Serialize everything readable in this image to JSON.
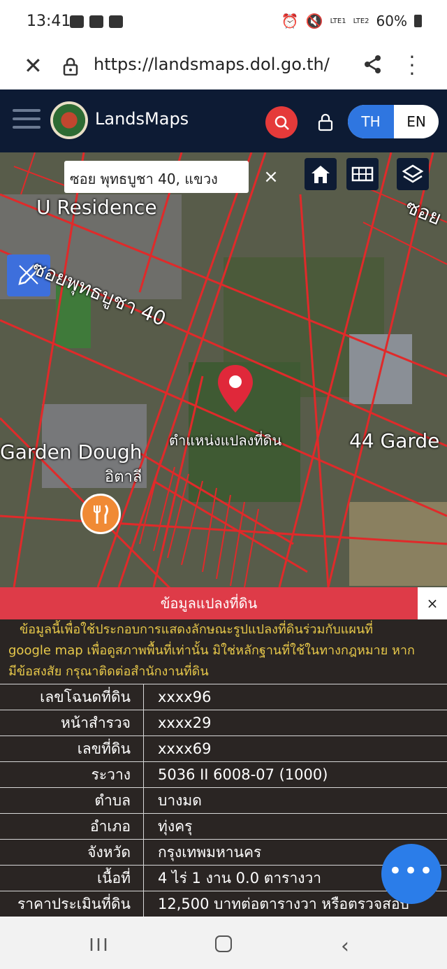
{
  "status_bar": {
    "time": "13:41",
    "signal1": "LTE1",
    "signal2": "LTE2",
    "battery": "60%"
  },
  "browser": {
    "url": "https://landsmaps.dol.go.th/"
  },
  "app": {
    "brand": "LandsMaps",
    "lang_th": "TH",
    "lang_en": "EN"
  },
  "map": {
    "search_value": "ซอย พุทธบูชา 40, แขวง",
    "clear_label": "×",
    "labels": {
      "residence": "U Residence",
      "road": "ซอยพุทธบูชา 40",
      "garden_dough": "Garden Dough",
      "garden_dough_th": "อิตาลี",
      "garden44": "44 Garde",
      "soi_top": "ซอย",
      "pin_label": "ตำแหน่งแปลงที่ดิน"
    }
  },
  "panel": {
    "title": "ข้อมูลแปลงที่ดิน",
    "close": "×",
    "notice_lines": [
      "ข้อมูลนี้เพื่อใช้ประกอบการแสดงลักษณะรูปแปลงที่ดินร่วมกับแผนที่",
      "google map เพื่อดูสภาพพื้นที่เท่านั้น มิใช่หลักฐานที่ใช้ในทางกฎหมาย หาก",
      "มีข้อสงสัย กรุณาติดต่อสำนักงานที่ดิน"
    ],
    "rows": [
      {
        "label": "เลขโฉนดที่ดิน",
        "value": "xxxx96"
      },
      {
        "label": "หน้าสำรวจ",
        "value": "xxxx29"
      },
      {
        "label": "เลขที่ดิน",
        "value": "xxxx69"
      },
      {
        "label": "ระวาง",
        "value": "5036 II 6008-07 (1000)"
      },
      {
        "label": "ตำบล",
        "value": "บางมด"
      },
      {
        "label": "อำเภอ",
        "value": "ทุ่งครุ"
      },
      {
        "label": "จังหวัด",
        "value": "กรุงเทพมหานคร"
      },
      {
        "label": "เนื้อที่",
        "value": "4 ไร่ 1 งาน 0.0 ตารางวา"
      },
      {
        "label": "ราคาประเมินที่ดิน",
        "value": "12,500 บาทต่อตารางวา หรือตรวจสอบ"
      }
    ]
  },
  "fab": {
    "label": "•••"
  },
  "colors": {
    "header": "#0d1b34",
    "accent_red": "#de3b48",
    "accent_blue": "#2f76e0",
    "notice_text": "#e8c94a"
  }
}
